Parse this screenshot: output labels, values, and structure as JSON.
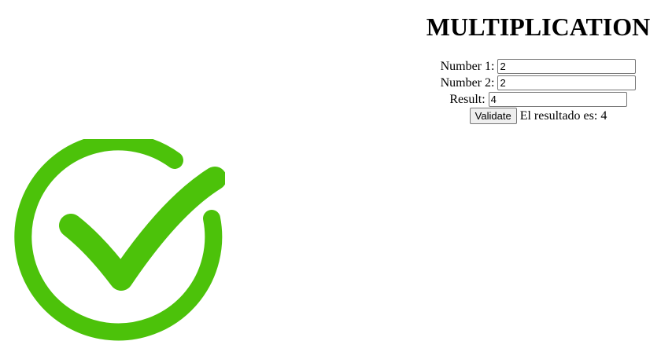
{
  "header": {
    "title": "MULTIPLICATION"
  },
  "form": {
    "number1_label": "Number 1:",
    "number1_value": "2",
    "number2_label": "Number 2:",
    "number2_value": "2",
    "result_label": "Result:",
    "result_value": "4",
    "validate_label": "Validate",
    "result_message": "El resultado es: 4"
  },
  "status_icon": {
    "name": "check-circle-icon",
    "color": "#4cc20a"
  }
}
